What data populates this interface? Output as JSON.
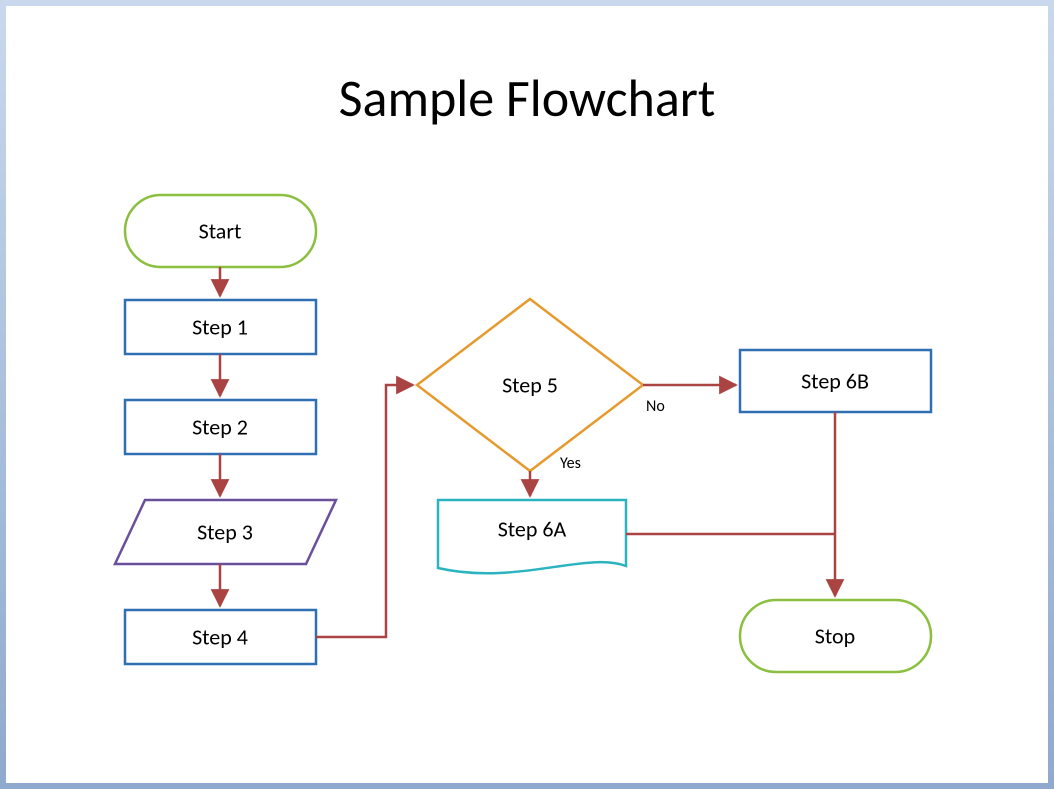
{
  "title": "Sample Flowchart",
  "nodes": {
    "start": {
      "label": "Start",
      "shape": "terminator",
      "color": "#8bbf3f"
    },
    "step1": {
      "label": "Step 1",
      "shape": "process",
      "color": "#2f6fb2"
    },
    "step2": {
      "label": "Step 2",
      "shape": "process",
      "color": "#2f6fb2"
    },
    "step3": {
      "label": "Step 3",
      "shape": "parallelogram",
      "color": "#6a4f9b"
    },
    "step4": {
      "label": "Step 4",
      "shape": "process",
      "color": "#2f6fb2"
    },
    "step5": {
      "label": "Step 5",
      "shape": "decision",
      "color": "#e59a2e"
    },
    "step6a": {
      "label": "Step 6A",
      "shape": "document",
      "color": "#2bb3c0"
    },
    "step6b": {
      "label": "Step 6B",
      "shape": "process",
      "color": "#2f6fb2"
    },
    "stop": {
      "label": "Stop",
      "shape": "terminator",
      "color": "#8bbf3f"
    }
  },
  "edges": [
    {
      "from": "start",
      "to": "step1"
    },
    {
      "from": "step1",
      "to": "step2"
    },
    {
      "from": "step2",
      "to": "step3"
    },
    {
      "from": "step3",
      "to": "step4"
    },
    {
      "from": "step4",
      "to": "step5"
    },
    {
      "from": "step5",
      "to": "step6a",
      "label": "Yes"
    },
    {
      "from": "step5",
      "to": "step6b",
      "label": "No"
    },
    {
      "from": "step6a",
      "to": "stop"
    },
    {
      "from": "step6b",
      "to": "stop"
    }
  ]
}
